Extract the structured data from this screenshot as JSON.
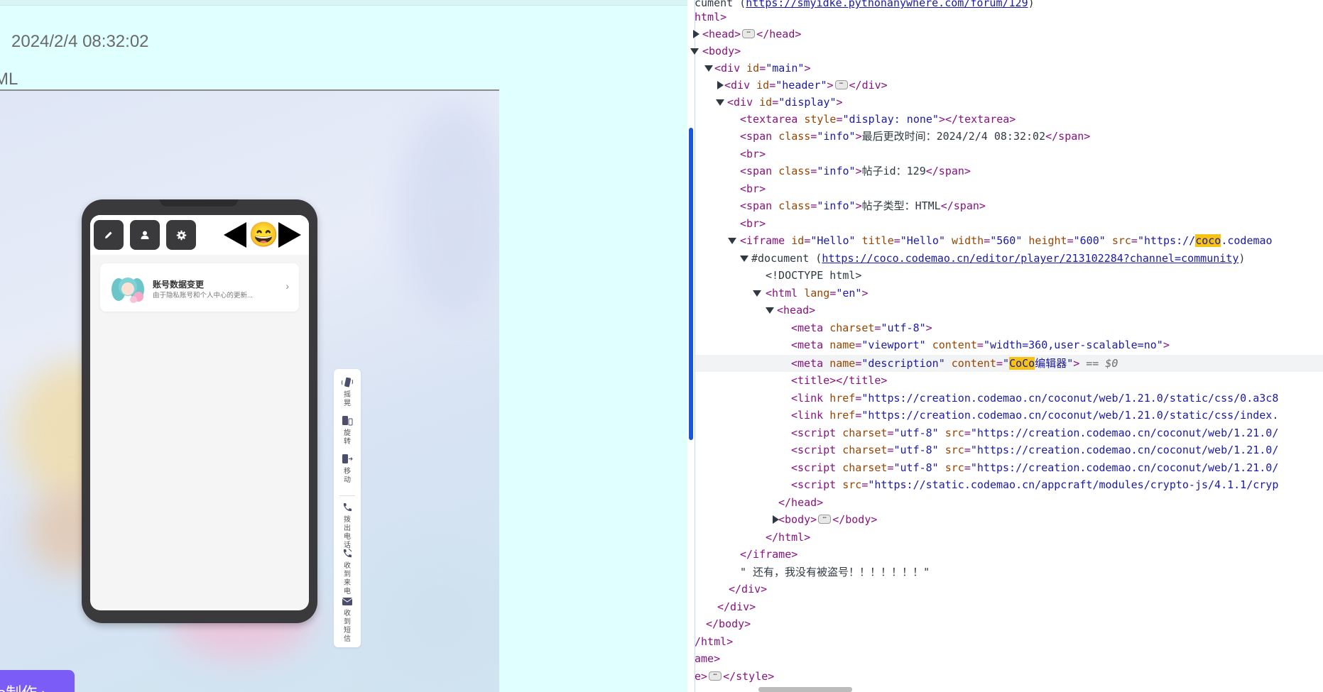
{
  "page": {
    "info_time": "：2024/2/4 08:32:02",
    "info_type": "ML",
    "coco_badge": "o制作 ›"
  },
  "phone": {
    "notice": {
      "title": "账号数据变更",
      "desc": "由于隐私账号和个人中心的更新..."
    },
    "emoji": "😄",
    "sim_panel": [
      {
        "label": "摇晃",
        "icon": "shake-icon"
      },
      {
        "label": "旋转",
        "icon": "rotate-icon"
      },
      {
        "label": "移动",
        "icon": "move-icon"
      },
      {
        "label": "拨出电话",
        "icon": "phone-out-icon"
      },
      {
        "label": "收到来电",
        "icon": "phone-in-icon"
      },
      {
        "label": "收到短信",
        "icon": "sms-icon"
      }
    ]
  },
  "devtools": {
    "l0_doc": "cument (",
    "l0_link": "https://smyidke.pythonanywhere.com/forum/129",
    "l0_end": ")",
    "l1": "html>",
    "l2_open": "<head>",
    "l2_close": "</head>",
    "l3": "<body>",
    "l4_a": "<div ",
    "l4_an": "id",
    "l4_av": "\"main\"",
    "l4_b": ">",
    "l5_a": "<div ",
    "l5_an": "id",
    "l5_av": "\"header\"",
    "l5_b": ">",
    "l5_c": "</div>",
    "l6_a": "<div ",
    "l6_an": "id",
    "l6_av": "\"display\"",
    "l6_b": ">",
    "l7_a": "<textarea ",
    "l7_an": "style",
    "l7_av": "\"display: none\"",
    "l7_b": "></textarea>",
    "l8_a": "<span ",
    "l8_an": "class",
    "l8_av": "\"info\"",
    "l8_b": ">",
    "l8_text": "最后更改时间：2024/2/4 08:32:02",
    "l8_c": "</span>",
    "br": "<br>",
    "l10_text": "帖子id：129",
    "l12_text": "帖子类型：HTML",
    "l14_a": "<iframe ",
    "l14_an1": "id",
    "l14_av1": "\"Hello\"",
    "l14_an2": "title",
    "l14_av2": "\"Hello\"",
    "l14_an3": "width",
    "l14_av3": "\"560\"",
    "l14_an4": "height",
    "l14_av4": "\"600\"",
    "l14_an5": "src",
    "l14_av5a": "\"https://",
    "l14_av5hl": "coco",
    "l14_av5b": ".codemao",
    "l15_doc": "#document (",
    "l15_link": "https://coco.codemao.cn/editor/player/213102284?channel=community",
    "l15_end": ")",
    "l16": "<!DOCTYPE html>",
    "l17_a": "<html ",
    "l17_an": "lang",
    "l17_av": "\"en\"",
    "l17_b": ">",
    "l18": "<head>",
    "l19_a": "<meta ",
    "l19_an": "charset",
    "l19_av": "\"utf-8\"",
    "l19_b": ">",
    "l20_a": "<meta ",
    "l20_an1": "name",
    "l20_av1": "\"viewport\"",
    "l20_an2": "content",
    "l20_av2": "\"width=360,user-scalable=no\"",
    "l20_b": ">",
    "l21_a": "<meta ",
    "l21_an1": "name",
    "l21_av1": "\"description\"",
    "l21_an2": "content",
    "l21_av2a": "\"",
    "l21_av2hl": "CoCo",
    "l21_av2b": "编辑器\"",
    "l21_b": ">",
    "l21_eq": "== $0",
    "l22": "<title></title>",
    "l23_a": "<link ",
    "l23_an": "href",
    "l23_av": "\"https://creation.codemao.cn/coconut/web/1.21.0/static/css/0.a3c8",
    "l24_av": "\"https://creation.codemao.cn/coconut/web/1.21.0/static/css/index.",
    "l25_a": "<script ",
    "l25_an1": "charset",
    "l25_av1": "\"utf-8\"",
    "l25_an2": "src",
    "l25_av2": "\"https://creation.codemao.cn/coconut/web/1.21.0/",
    "l29_av": "\"https://static.codemao.cn/appcraft/modules/crypto-js/4.1.1/cryp",
    "l30": "</head>",
    "l31_a": "<body>",
    "l31_b": "</body>",
    "l32": "</html>",
    "l33": "</iframe>",
    "l34": "\" 还有，我没有被盗号！！！！！！！\"",
    "l35": "</div>",
    "l36": "</div>",
    "l37": "</body>",
    "l38": "/html>",
    "l39": "ame>",
    "l40_a": "e>",
    "l40_b": "</style>"
  }
}
